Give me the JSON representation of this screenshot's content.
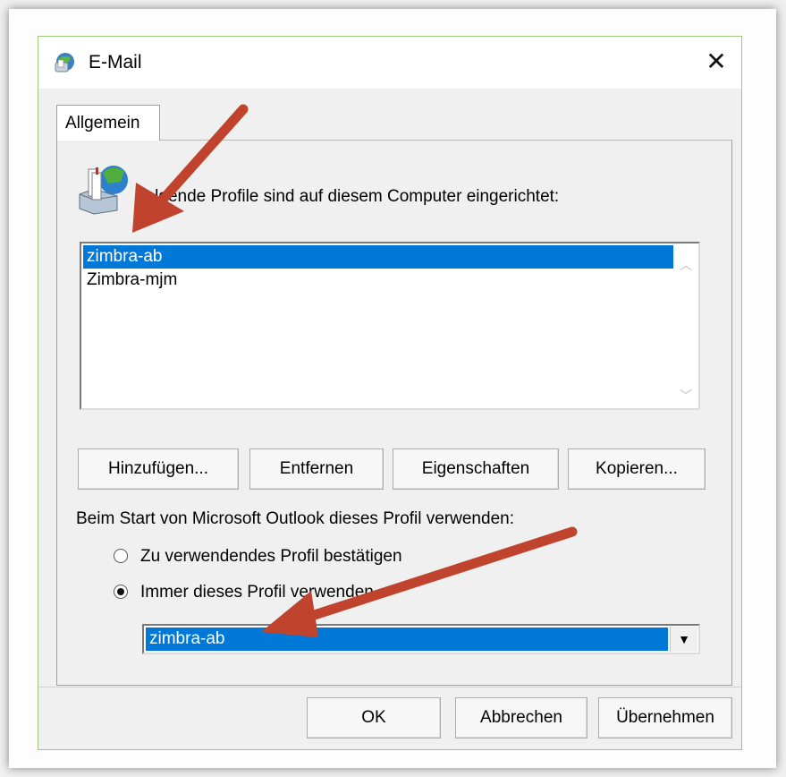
{
  "window": {
    "title": "E-Mail",
    "close_glyph": "✕",
    "icon": "mail-globe-icon"
  },
  "tabs": [
    {
      "label": "Allgemein",
      "active": true
    }
  ],
  "profiles": {
    "label": "Folgende Profile sind auf diesem Computer eingerichtet:",
    "items": [
      {
        "label": "zimbra-ab",
        "selected": true
      },
      {
        "label": "Zimbra-mjm",
        "selected": false
      }
    ]
  },
  "buttons": {
    "add": "Hinzufügen...",
    "remove": "Entfernen",
    "properties": "Eigenschaften",
    "copy": "Kopieren..."
  },
  "startup": {
    "label": "Beim Start von Microsoft Outlook dieses Profil verwenden:",
    "options": [
      {
        "label": "Zu verwendendes Profil bestätigen",
        "checked": false
      },
      {
        "label": "Immer dieses Profil verwenden",
        "checked": true
      }
    ],
    "selected_profile": "zimbra-ab"
  },
  "footer": {
    "ok": "OK",
    "cancel": "Abbrechen",
    "apply": "Übernehmen"
  },
  "colors": {
    "selection": "#0078d7",
    "annotation_arrow": "#c0442d",
    "window_border": "#9cc97a"
  }
}
